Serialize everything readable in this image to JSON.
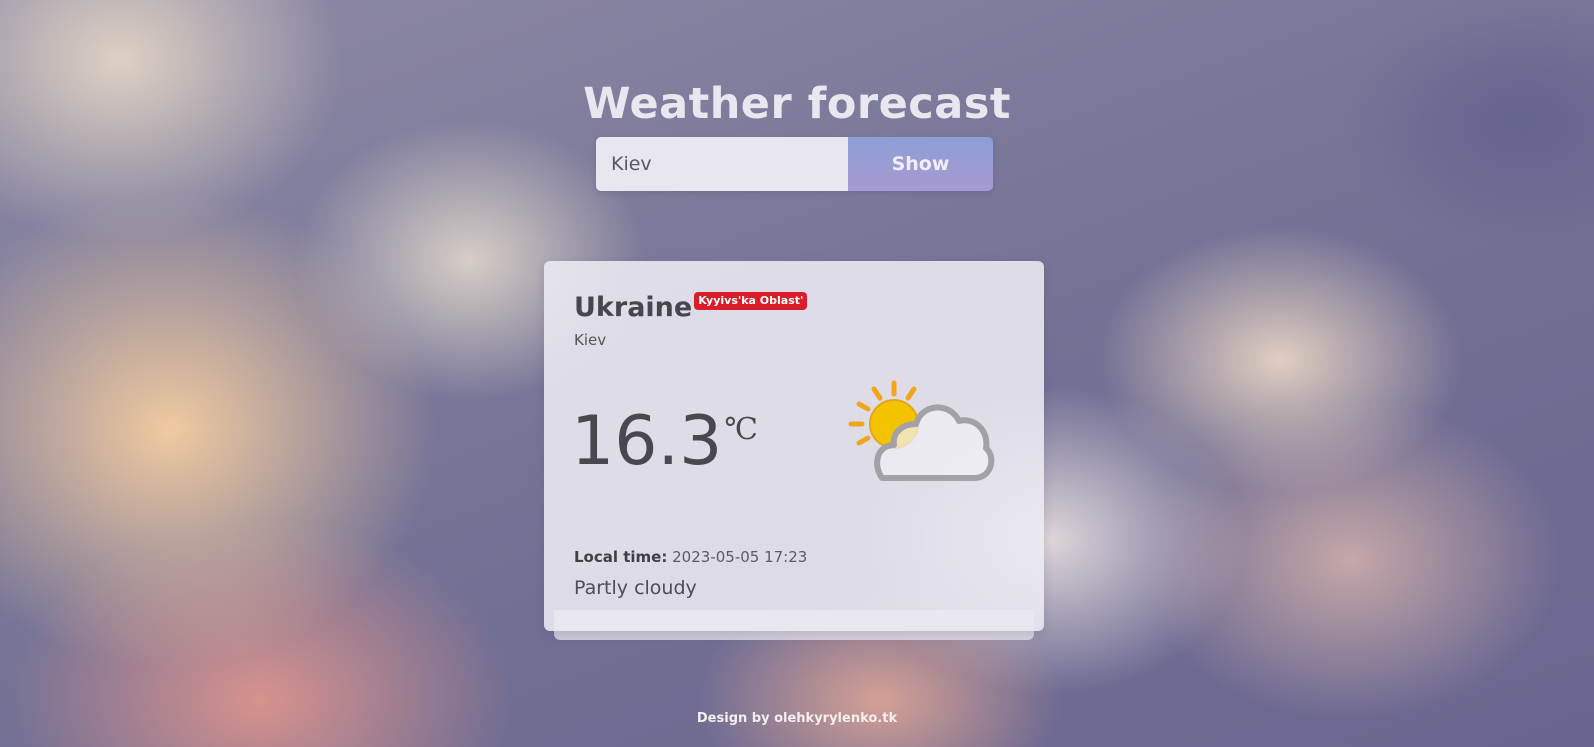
{
  "page": {
    "title": "Weather forecast",
    "footer": "Design by olehkyrylenko.tk"
  },
  "search": {
    "value": "Kiev",
    "button_label": "Show"
  },
  "weather": {
    "country": "Ukraine",
    "region": "Kyyivs'ka Oblast'",
    "city": "Kiev",
    "temperature": "16.3",
    "unit": "℃",
    "icon": "partly-cloudy-icon",
    "local_time_label": "Local time:",
    "local_time": "2023-05-05 17:23",
    "condition": "Partly cloudy"
  },
  "colors": {
    "badge": "#d91d2a",
    "button_gradient_top": "#8b9fd6",
    "button_gradient_bottom": "#a999d1",
    "sun": "#f5c400",
    "sun_rays": "#f2a51b"
  }
}
